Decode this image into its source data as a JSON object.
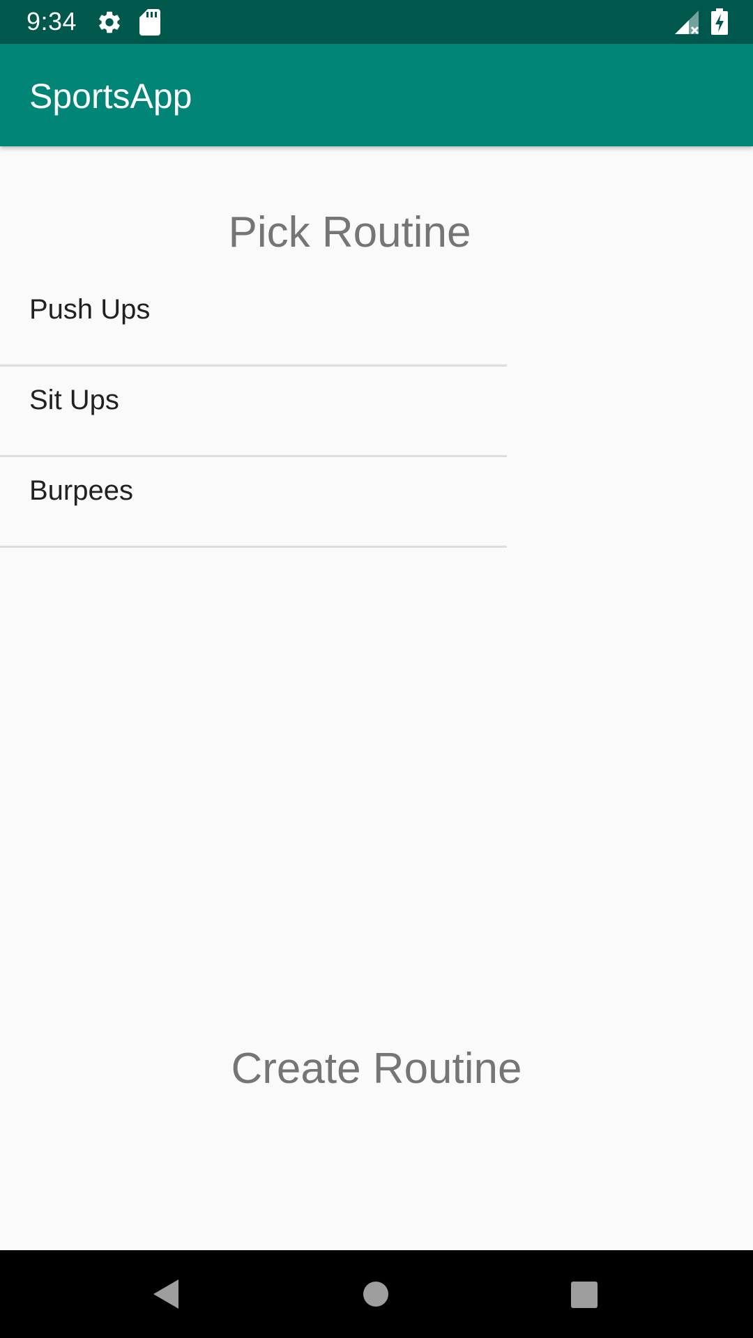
{
  "status_bar": {
    "time": "9:34",
    "icons": [
      "gear-icon",
      "sd-card-icon",
      "signal-icon",
      "battery-charging-icon"
    ],
    "background": "#00574b"
  },
  "app_bar": {
    "title": "SportsApp",
    "background": "#008577"
  },
  "main": {
    "pick_title": "Pick Routine",
    "routines": [
      {
        "label": "Push Ups"
      },
      {
        "label": "Sit Ups"
      },
      {
        "label": "Burpees"
      }
    ],
    "create_label": "Create Routine"
  },
  "nav_bar": {
    "buttons": [
      "back-icon",
      "home-icon",
      "recents-icon"
    ]
  }
}
